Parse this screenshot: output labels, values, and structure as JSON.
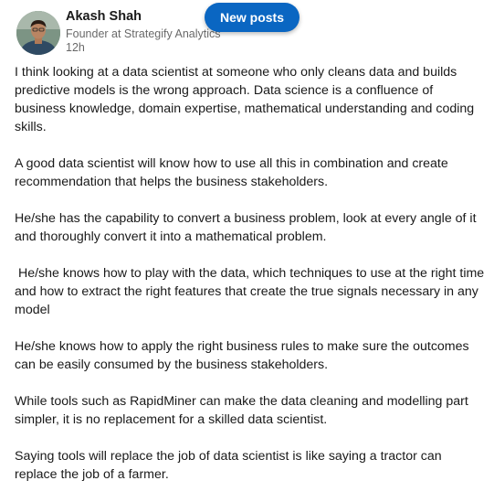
{
  "post": {
    "author": {
      "name": "Akash Shah",
      "headline": "Founder at Strategify Analytics",
      "timestamp": "12h"
    },
    "paragraphs": [
      "I think looking at a data scientist at someone who only cleans data and builds predictive models is the wrong approach. Data science is a confluence of business knowledge, domain expertise, mathematical understanding and coding skills.",
      "A good data scientist will know how to use all this in combination and create recommendation that helps the business stakeholders.",
      "He/she has the capability to convert a business problem, look at every angle of it and thoroughly convert it into a mathematical problem.",
      " He/she knows how to play with the data, which techniques to use at the right time and how to extract the right features that create the true signals necessary in any model",
      "He/she knows how to apply the right business rules to make sure the outcomes can be easily consumed by the business stakeholders.",
      "While tools such as RapidMiner can make the data cleaning and modelling part simpler, it is no replacement for a skilled data scientist.",
      "Saying tools will replace the job of data scientist is like saying a tractor can replace the job of a farmer."
    ]
  },
  "feed": {
    "new_posts_label": "New posts"
  },
  "colors": {
    "accent": "#0a66c2",
    "text_primary": "#191919",
    "text_secondary": "#666666"
  }
}
